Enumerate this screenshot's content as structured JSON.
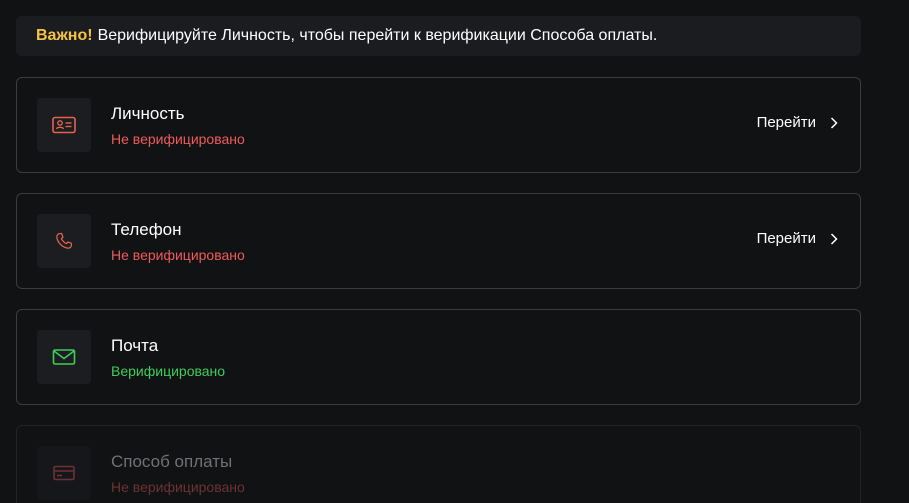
{
  "notice": {
    "important_label": "Важно!",
    "message": "Верифицируйте Личность, чтобы перейти к верификации Способа оплаты."
  },
  "colors": {
    "background": "#111214",
    "accent_warning": "#f5c242",
    "status_unverified": "#ef5a5a",
    "status_verified": "#3fcc5a"
  },
  "items": [
    {
      "icon": "id-card-icon",
      "title": "Личность",
      "status": "Не верифицировано",
      "action": "Перейти"
    },
    {
      "icon": "phone-icon",
      "title": "Телефон",
      "status": "Не верифицировано",
      "action": "Перейти"
    },
    {
      "icon": "mail-icon",
      "title": "Почта",
      "status": "Верифицировано"
    },
    {
      "icon": "credit-card-icon",
      "title": "Способ оплаты",
      "status": "Не верифицировано"
    }
  ]
}
